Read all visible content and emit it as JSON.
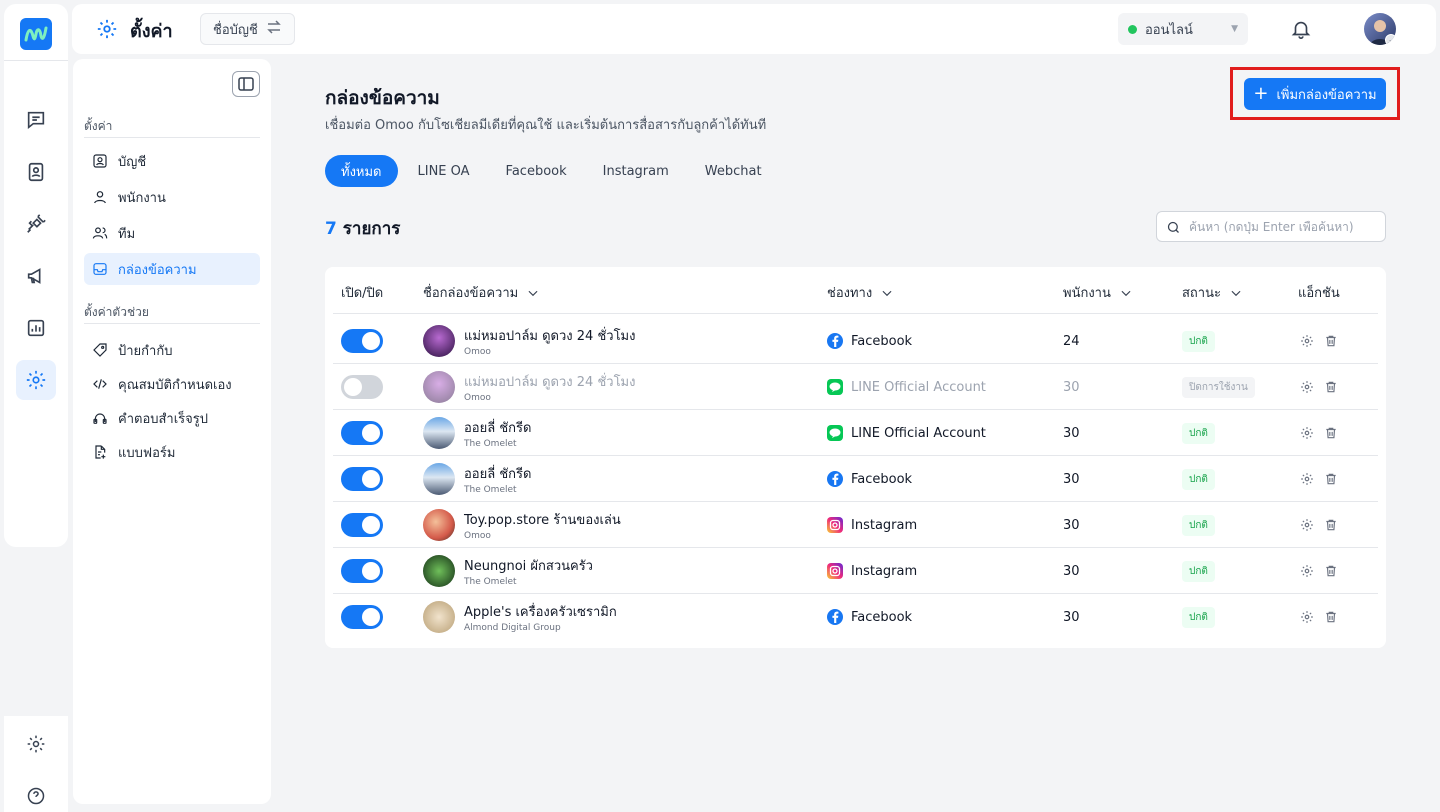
{
  "header": {
    "title": "ตั้งค่า",
    "account_switch": "ชื่อบัญชี",
    "status": "ออนไลน์"
  },
  "settings_sidebar": {
    "section1": "ตั้งค่า",
    "items1": [
      {
        "label": "บัญชี",
        "icon": "user-square-icon"
      },
      {
        "label": "พนักงาน",
        "icon": "user-icon"
      },
      {
        "label": "ทีม",
        "icon": "users-icon"
      },
      {
        "label": "กล่องข้อความ",
        "icon": "inbox-icon"
      }
    ],
    "section2": "ตั้งค่าตัวช่วย",
    "items2": [
      {
        "label": "ป้ายกำกับ",
        "icon": "tag-icon"
      },
      {
        "label": "คุณสมบัติกำหนดเอง",
        "icon": "code-icon"
      },
      {
        "label": "คำตอบสำเร็จรูป",
        "icon": "quick-reply-icon"
      },
      {
        "label": "แบบฟอร์ม",
        "icon": "form-icon"
      }
    ]
  },
  "page": {
    "title": "กล่องข้อความ",
    "subtitle": "เชื่อมต่อ Omoo กับโซเชียลมีเดียที่คุณใช้ และเริ่มต้นการสื่อสารกับลูกค้าได้ทันที",
    "add_button": "เพิ่มกล่องข้อความ",
    "tabs": [
      "ทั้งหมด",
      "LINE OA",
      "Facebook",
      "Instagram",
      "Webchat"
    ],
    "count_num": "7",
    "count_label": "รายการ",
    "search_placeholder": "ค้นหา (กดปุ่ม Enter เพื่อค้นหา)"
  },
  "table": {
    "headers": {
      "toggle": "เปิด/ปิด",
      "name": "ชื่อกล่องข้อความ",
      "channel": "ช่องทาง",
      "staff": "พนักงาน",
      "status": "สถานะ",
      "actions": "แอ็กชัน"
    },
    "rows": [
      {
        "enabled": true,
        "name": "แม่หมอปาล์ม ดูดวง 24 ชั่วโมง",
        "sub": "Omoo",
        "channel": "Facebook",
        "staff": "24",
        "status": "ปกติ"
      },
      {
        "enabled": false,
        "name": "แม่หมอปาล์ม ดูดวง 24 ชั่วโมง",
        "sub": "Omoo",
        "channel": "LINE Official Account",
        "staff": "30",
        "status": "ปิดการใช้งาน"
      },
      {
        "enabled": true,
        "name": "ออยลี่ ชักรีด",
        "sub": "The Omelet",
        "channel": "LINE Official Account",
        "staff": "30",
        "status": "ปกติ"
      },
      {
        "enabled": true,
        "name": "ออยลี่ ชักรีด",
        "sub": "The Omelet",
        "channel": "Facebook",
        "staff": "30",
        "status": "ปกติ"
      },
      {
        "enabled": true,
        "name": "Toy.pop.store ร้านของเล่น",
        "sub": "Omoo",
        "channel": "Instagram",
        "staff": "30",
        "status": "ปกติ"
      },
      {
        "enabled": true,
        "name": "Neungnoi ผักสวนครัว",
        "sub": "The Omelet",
        "channel": "Instagram",
        "staff": "30",
        "status": "ปกติ"
      },
      {
        "enabled": true,
        "name": "Apple's เครื่องครัวเซรามิก",
        "sub": "Almond Digital Group",
        "channel": "Facebook",
        "staff": "30",
        "status": "ปกติ"
      }
    ]
  },
  "colors": {
    "accent": "#1578f5",
    "facebook": "#1877f2",
    "line": "#06c755",
    "highlight": "#e11d1d"
  }
}
